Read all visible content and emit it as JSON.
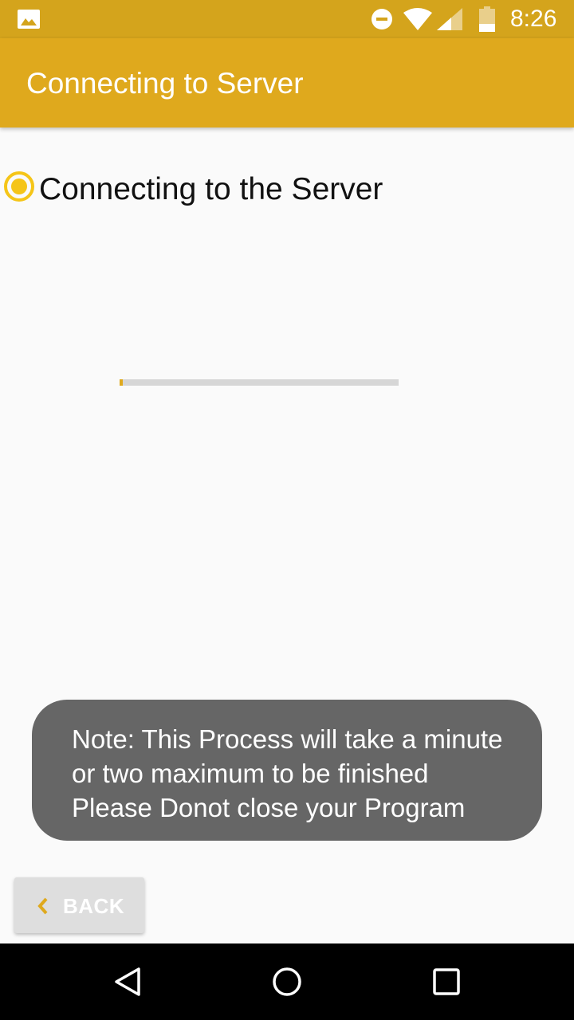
{
  "status_bar": {
    "time": "8:26",
    "icons": [
      "gallery-icon",
      "do-not-disturb-icon",
      "wifi-icon",
      "signal-icon",
      "battery-icon"
    ]
  },
  "app_bar": {
    "title": "Connecting to Server"
  },
  "step": {
    "label": "Connecting to the Server",
    "state": "active"
  },
  "progress": {
    "value": 0.01
  },
  "toast": {
    "lines": [
      "Note: This Process will take a minute",
      "or two maximum to be finished",
      "Please Donot close your Program"
    ]
  },
  "back_button": {
    "label": "BACK"
  },
  "nav_bar": {
    "buttons": [
      "back",
      "home",
      "recents"
    ]
  },
  "colors": {
    "status_bar": "#d4a41c",
    "app_bar": "#dfa91d",
    "accent": "#dfa91d",
    "radio": "#f5c518",
    "toast_bg": "#666666",
    "progress_track": "#d6d6d6"
  }
}
